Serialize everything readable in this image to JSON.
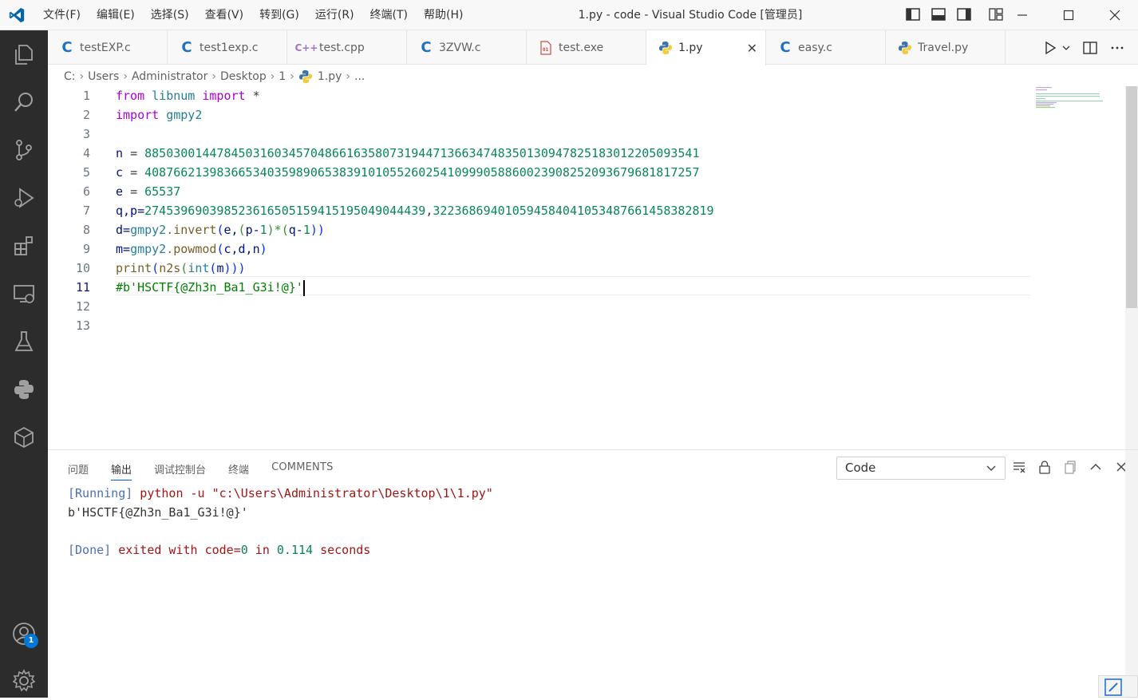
{
  "titlebar": {
    "menu": [
      "文件(F)",
      "编辑(E)",
      "选择(S)",
      "查看(V)",
      "转到(G)",
      "运行(R)",
      "终端(T)",
      "帮助(H)"
    ],
    "title": "1.py - code - Visual Studio Code [管理员]"
  },
  "tabs": [
    {
      "label": "testEXP.c",
      "icon": "c-file-icon"
    },
    {
      "label": "test1exp.c",
      "icon": "c-file-icon"
    },
    {
      "label": "test.cpp",
      "icon": "cpp-file-icon"
    },
    {
      "label": "3ZVW.c",
      "icon": "c-file-icon"
    },
    {
      "label": "test.exe",
      "icon": "binary-file-icon"
    },
    {
      "label": "1.py",
      "icon": "python-file-icon",
      "active": true
    },
    {
      "label": "easy.c",
      "icon": "c-file-icon"
    },
    {
      "label": "Travel.py",
      "icon": "python-file-icon"
    }
  ],
  "breadcrumb": [
    "C:",
    "Users",
    "Administrator",
    "Desktop",
    "1",
    "1.py",
    "..."
  ],
  "editor": {
    "line_numbers": [
      "1",
      "2",
      "3",
      "4",
      "5",
      "6",
      "7",
      "8",
      "9",
      "10",
      "11",
      "12",
      "13"
    ],
    "current_line": "11",
    "lines": {
      "l1": [
        "from",
        "libnum",
        "import",
        "*"
      ],
      "l2": [
        "import",
        "gmpy2"
      ],
      "l4": [
        "n",
        "=",
        "88503001447845031603457048661635807319447136634748350130947825183012205093541"
      ],
      "l5": [
        "c",
        "=",
        "40876621398366534035989065383910105526025410999058860023908252093679681817257"
      ],
      "l6": [
        "e",
        "=",
        "65537"
      ],
      "l7": [
        "q,p=",
        "274539690398523616505159415195049044439",
        ",",
        "322368694010594584041053487661458382819"
      ],
      "l8": [
        "d=",
        "gmpy2",
        ".invert",
        "(",
        "e,",
        "(",
        "p-",
        "1",
        ")*(",
        "q-",
        "1",
        "))"
      ],
      "l9": [
        "m=",
        "gmpy2",
        ".powmod",
        "(",
        "c,d,n",
        ")"
      ],
      "l10": [
        "print",
        "(",
        "n2s",
        "(",
        "int",
        "(",
        "m",
        ")))"
      ],
      "l11": "#b'HSCTF{@Zh3n_Ba1_G3i!@}'"
    }
  },
  "panel": {
    "tabs": [
      "问题",
      "输出",
      "调试控制台",
      "终端",
      "COMMENTS"
    ],
    "active_tab": "输出",
    "channel": "Code",
    "output": {
      "run_tag": "[Running]",
      "run_cmd": " python -u \"c:\\Users\\Administrator\\Desktop\\1\\1.py\"",
      "result": "b'HSCTF{@Zh3n_Ba1_G3i!@}'",
      "done_tag": "[Done]",
      "done_text1": " exited with code=",
      "done_code": "0",
      "done_text2": " in ",
      "done_time": "0.114",
      "done_text3": " seconds"
    }
  },
  "activitybar": {
    "accounts_badge": "1"
  },
  "colors": {
    "accent": "#005fb8",
    "badge": "#0078d4",
    "activitybar": "#2c2c2c"
  }
}
